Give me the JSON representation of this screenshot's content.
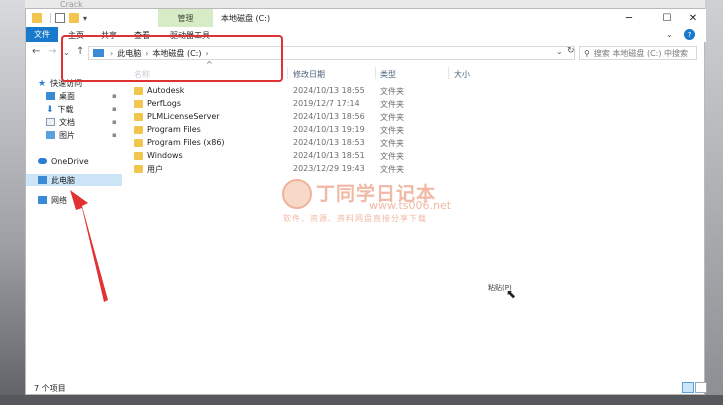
{
  "background": {
    "top_text": "Crack"
  },
  "window": {
    "title": "本地磁盘 (C:)",
    "manage_tab": "管理",
    "controls": {
      "minimize": "─",
      "maximize": "☐",
      "close": "✕"
    }
  },
  "ribbon": {
    "file_tab": "文件",
    "tabs": [
      "主页",
      "共享",
      "查看",
      "驱动器工具"
    ],
    "help": "?",
    "collapse": "⌄"
  },
  "nav": {
    "back": "←",
    "forward": "→",
    "recent": "⌄",
    "up": "↑",
    "breadcrumbs": [
      "此电脑",
      "本地磁盘 (C:)"
    ],
    "dropdown": "⌄",
    "refresh": "↻",
    "search_placeholder": "搜索 本地磁盘 (C:) 中搜索"
  },
  "sidebar": {
    "quick_access": "快速访问",
    "items": [
      {
        "label": "桌面",
        "icon": "desktop-icon",
        "pinned": true
      },
      {
        "label": "下载",
        "icon": "download-icon",
        "pinned": true
      },
      {
        "label": "文档",
        "icon": "document-icon",
        "pinned": true
      },
      {
        "label": "图片",
        "icon": "picture-icon",
        "pinned": true
      }
    ],
    "onedrive": "OneDrive",
    "this_pc": "此电脑",
    "network": "网络",
    "pin_glyph": "📌"
  },
  "columns": {
    "name": "名称",
    "date": "修改日期",
    "type": "类型",
    "size": "大小",
    "sort_chevron": "^"
  },
  "files": [
    {
      "name": "Autodesk",
      "date": "2024/10/13 18:55",
      "type": "文件夹"
    },
    {
      "name": "PerfLogs",
      "date": "2019/12/7 17:14",
      "type": "文件夹"
    },
    {
      "name": "PLMLicenseServer",
      "date": "2024/10/13 18:56",
      "type": "文件夹"
    },
    {
      "name": "Program Files",
      "date": "2024/10/13 19:19",
      "type": "文件夹"
    },
    {
      "name": "Program Files (x86)",
      "date": "2024/10/13 18:53",
      "type": "文件夹"
    },
    {
      "name": "Windows",
      "date": "2024/10/13 18:51",
      "type": "文件夹"
    },
    {
      "name": "用户",
      "date": "2023/12/29 19:43",
      "type": "文件夹"
    }
  ],
  "watermark": {
    "title": "丁同学日记本",
    "url": "www.ts006.net",
    "subtitle": "软件、资源、资料网盘直接分享下载"
  },
  "tooltip": "粘贴(P)",
  "status": {
    "count": "7 个项目"
  },
  "colors": {
    "accent": "#1979ca",
    "manage": "#d7ebc7",
    "annotation": "#e03232"
  }
}
